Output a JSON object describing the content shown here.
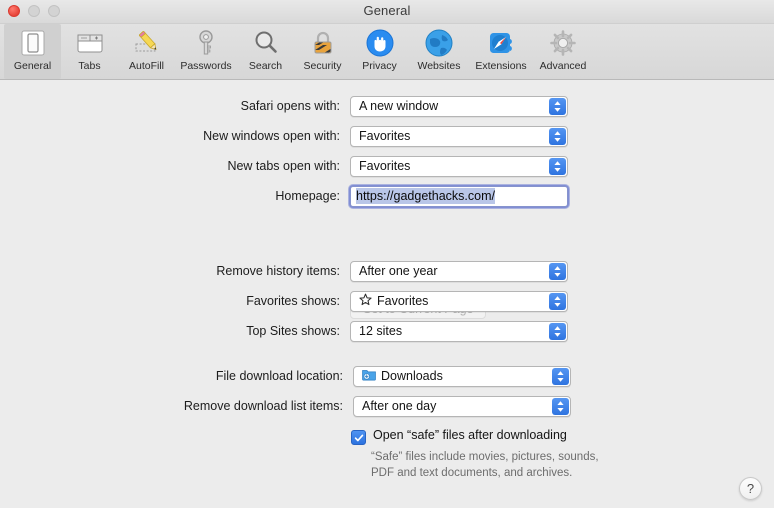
{
  "window": {
    "title": "General",
    "traffic_lights": [
      "close",
      "minimize",
      "zoom"
    ]
  },
  "toolbar": {
    "items": [
      {
        "label": "General",
        "icon": "general-icon",
        "selected": true
      },
      {
        "label": "Tabs",
        "icon": "tabs-icon",
        "selected": false
      },
      {
        "label": "AutoFill",
        "icon": "autofill-icon",
        "selected": false
      },
      {
        "label": "Passwords",
        "icon": "passwords-icon",
        "selected": false
      },
      {
        "label": "Search",
        "icon": "search-icon",
        "selected": false
      },
      {
        "label": "Security",
        "icon": "security-icon",
        "selected": false
      },
      {
        "label": "Privacy",
        "icon": "privacy-icon",
        "selected": false
      },
      {
        "label": "Websites",
        "icon": "websites-icon",
        "selected": false
      },
      {
        "label": "Extensions",
        "icon": "extensions-icon",
        "selected": false
      },
      {
        "label": "Advanced",
        "icon": "advanced-icon",
        "selected": false
      }
    ]
  },
  "form": {
    "safari_opens_with": {
      "label": "Safari opens with:",
      "value": "A new window"
    },
    "new_windows_open_with": {
      "label": "New windows open with:",
      "value": "Favorites"
    },
    "new_tabs_open_with": {
      "label": "New tabs open with:",
      "value": "Favorites"
    },
    "homepage": {
      "label": "Homepage:",
      "value": "https://gadgethacks.com/"
    },
    "set_to_current_page": {
      "label": "Set to Current Page",
      "enabled": false
    },
    "remove_history_items": {
      "label": "Remove history items:",
      "value": "After one year"
    },
    "favorites_shows": {
      "label": "Favorites shows:",
      "value": "Favorites",
      "icon": "star-icon"
    },
    "top_sites_shows": {
      "label": "Top Sites shows:",
      "value": "12 sites"
    },
    "file_download_location": {
      "label": "File download location:",
      "value": "Downloads",
      "icon": "downloads-folder-icon"
    },
    "remove_download_list": {
      "label": "Remove download list items:",
      "value": "After one day"
    },
    "open_safe_files": {
      "label": "Open “safe” files after downloading",
      "checked": true
    },
    "open_safe_files_help": "“Safe” files include movies, pictures, sounds, PDF and text documents, and archives."
  },
  "help_button": {
    "label": "?"
  },
  "colors": {
    "accent_blue": "#2f74e0",
    "window_bg": "#ececec",
    "toolbar_bg": "#dcdcdc",
    "selection_blue": "#b9c6e8"
  }
}
